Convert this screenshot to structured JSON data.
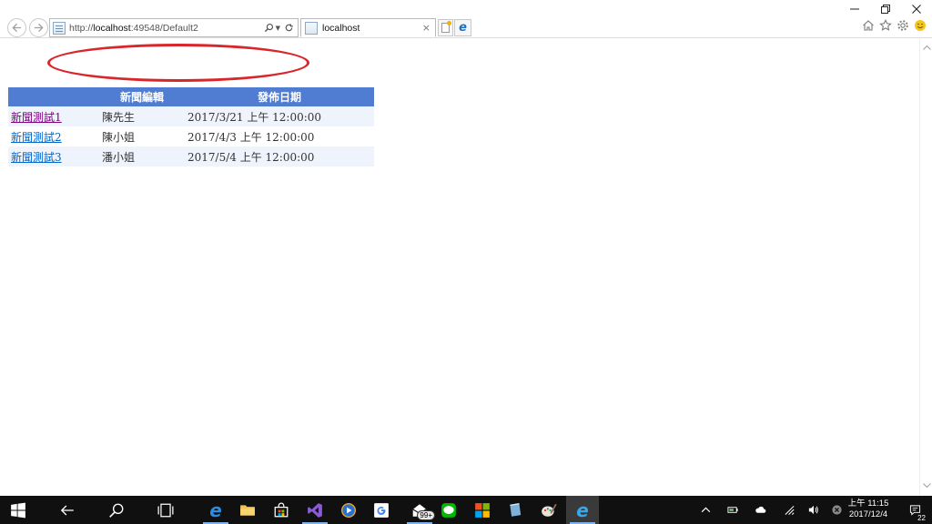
{
  "browser": {
    "url_prefix": "http://",
    "url_host": "localhost",
    "url_path": ":49548/Default2",
    "tab_title": "localhost",
    "tab_close": "×"
  },
  "table": {
    "headers": [
      "",
      "新聞編輯",
      "發佈日期"
    ],
    "rows": [
      {
        "title": "新聞測試1",
        "editor": "陳先生",
        "date": "2017/3/21 上午 12:00:00",
        "visited": true
      },
      {
        "title": "新聞測試2",
        "editor": "陳小姐",
        "date": "2017/4/3 上午 12:00:00",
        "visited": false
      },
      {
        "title": "新聞測試3",
        "editor": "潘小姐",
        "date": "2017/5/4 上午 12:00:00",
        "visited": false
      }
    ]
  },
  "taskbar": {
    "mail_badge": "99+",
    "clock_time": "上午 11:15",
    "clock_date": "2017/12/4",
    "notifications": "22"
  },
  "colors": {
    "header_bg": "#507cd1",
    "alt_row_bg": "#eff3fb",
    "annotation": "#d8262b",
    "link": "#0066cc",
    "visited_link": "#800080"
  }
}
